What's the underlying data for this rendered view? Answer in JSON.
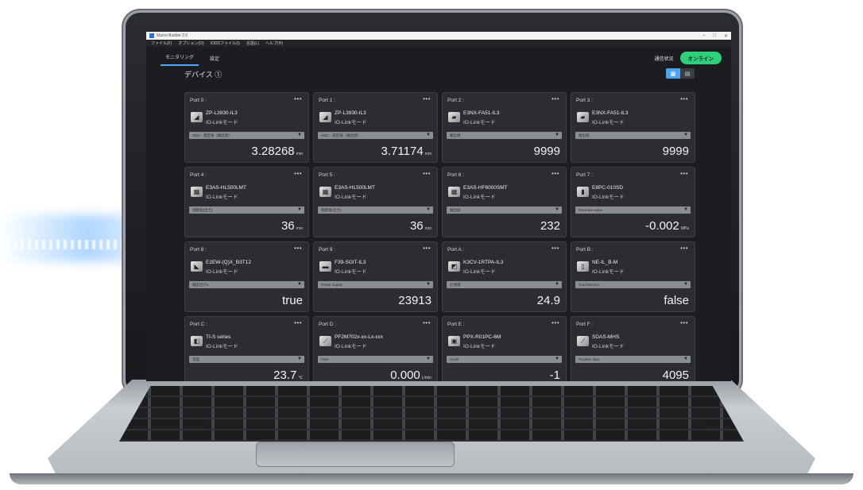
{
  "window": {
    "title": "Macro Builder 2.0",
    "menu": [
      "ファイル(F)",
      "オプション(O)",
      "IODDファイル(I)",
      "言語(L)",
      "ヘルプ(H)"
    ]
  },
  "tabs": [
    {
      "label": "モニタリング",
      "active": true
    },
    {
      "label": "設定",
      "active": false
    }
  ],
  "connection": {
    "label": "通信状況",
    "status": "オンライン",
    "color": "#2fd07b"
  },
  "devices": {
    "heading": "デバイス ①",
    "more": "•••",
    "caret": "▼",
    "cards": [
      {
        "port": "Port 0 :",
        "model": "ZP-L3930-IL3",
        "sub": "IO-Linkモード",
        "select": "HDC - 測定値（検出値）",
        "value": "3.28268",
        "unit": "mm",
        "icon": "displacement-sensor-icon"
      },
      {
        "port": "Port 1 :",
        "model": "ZP-L3930-IL3",
        "sub": "IO-Linkモード",
        "select": "MDC - 測定値（検出値）",
        "value": "3.71174",
        "unit": "mm",
        "icon": "displacement-sensor-icon"
      },
      {
        "port": "Port 2 :",
        "model": "E3NX-FA51-IL3",
        "sub": "IO-Linkモード",
        "select": "検出値",
        "value": "9999",
        "unit": "",
        "icon": "fiber-amp-icon"
      },
      {
        "port": "Port 3 :",
        "model": "E3NX-FA51-IL3",
        "sub": "IO-Linkモード",
        "select": "検出値",
        "value": "9999",
        "unit": "",
        "icon": "fiber-amp-icon"
      },
      {
        "port": "Port 4 :",
        "model": "E3AS-HL500LMT",
        "sub": "IO-Linkモード",
        "select": "測距値(出力)",
        "value": "36",
        "unit": "mm",
        "icon": "photoelectric-sensor-icon"
      },
      {
        "port": "Port 5 :",
        "model": "E3AS-HL500LMT",
        "sub": "IO-Linkモード",
        "select": "測距値(出力)",
        "value": "36",
        "unit": "mm",
        "icon": "photoelectric-sensor-icon"
      },
      {
        "port": "Port 6 :",
        "model": "E3AS-HF6000SMT",
        "sub": "IO-Linkモード",
        "select": "検出値",
        "value": "232",
        "unit": "",
        "icon": "photoelectric-sensor-icon"
      },
      {
        "port": "Port 7 :",
        "model": "E8PC-010SD",
        "sub": "IO-Linkモード",
        "select": "Pressure value",
        "value": "-0.002",
        "unit": "MPa",
        "icon": "pressure-sensor-icon"
      },
      {
        "port": "Port 8 :",
        "model": "E2EW-(Q)X_B3T12",
        "sub": "IO-Linkモード",
        "select": "検出出力1",
        "value": "true",
        "unit": "",
        "icon": "proximity-sensor-icon"
      },
      {
        "port": "Port 9 :",
        "model": "F39-SGIT-IL3",
        "sub": "IO-Linkモード",
        "select": "Power supply",
        "value": "23913",
        "unit": "",
        "icon": "safety-sensor-icon"
      },
      {
        "port": "Port A :",
        "model": "K3CV-1RTPA-IL3",
        "sub": "IO-Linkモード",
        "select": "計測値",
        "value": "24.9",
        "unit": "",
        "icon": "controller-icon"
      },
      {
        "port": "Port B :",
        "model": "NE-IL_B-M",
        "sub": "IO-Linkモード",
        "select": "TouchSensor",
        "value": "false",
        "unit": "",
        "icon": "touch-sensor-icon"
      },
      {
        "port": "Port C :",
        "model": "TI-S series",
        "sub": "IO-Linkモード",
        "select": "温度",
        "value": "23.7",
        "unit": "℃",
        "icon": "temperature-sensor-icon"
      },
      {
        "port": "Port D :",
        "model": "PF2M702x-xx-Lx-xxx",
        "sub": "IO-Linkモード",
        "select": "Flow",
        "value": "0.000",
        "unit": "L/min",
        "icon": "flow-sensor-icon"
      },
      {
        "port": "Port E :",
        "model": "PPX-R01PC-6M",
        "sub": "IO-Linkモード",
        "select": "Scale",
        "value": "-1",
        "unit": "",
        "icon": "pressure-gauge-icon"
      },
      {
        "port": "Port F :",
        "model": "SDAS-MHS",
        "sub": "IO-Linkモード",
        "select": "Position data",
        "value": "4095",
        "unit": "",
        "icon": "position-sensor-icon"
      }
    ]
  },
  "view_toggle": {
    "grid": "▦",
    "list": "▤"
  }
}
